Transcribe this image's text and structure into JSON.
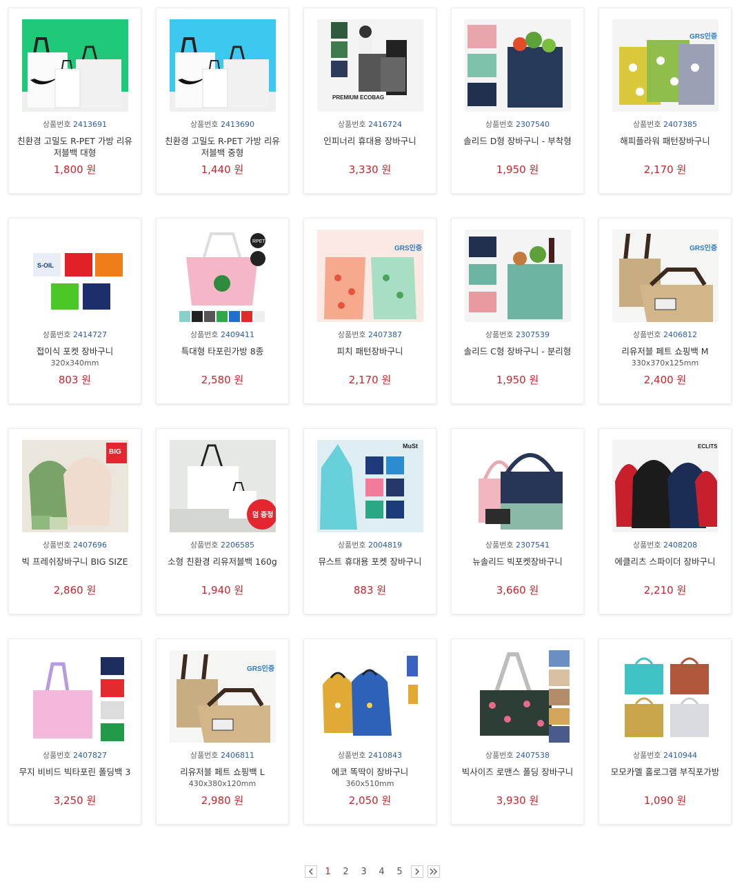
{
  "code_label": "상품번호",
  "currency": "원",
  "products": [
    {
      "code": "2413691",
      "name": "친환경 고밀도 R-PET 가방 리유저블백 대형",
      "size": "",
      "price": "1,800",
      "img": "nike-white-green"
    },
    {
      "code": "2413690",
      "name": "친환경 고밀도 R-PET 가방 리유저블백 중형",
      "size": "",
      "price": "1,440",
      "img": "nike-white-blue"
    },
    {
      "code": "2416724",
      "name": "인피너리 휴대용 장바구니",
      "size": "",
      "price": "3,330",
      "img": "models-ecobag"
    },
    {
      "code": "2307540",
      "name": "솔리드 D형 장바구니 - 부착형",
      "size": "",
      "price": "1,950",
      "img": "solid-d-navy"
    },
    {
      "code": "2407385",
      "name": "해피플라워 패턴장바구니",
      "size": "",
      "price": "2,170",
      "img": "flower-pattern"
    },
    {
      "code": "2414727",
      "name": "접이식 포켓 장바구니",
      "size": "320x340mm",
      "price": "803",
      "img": "pocket-colors"
    },
    {
      "code": "2409411",
      "name": "특대형 타포린가방 8종",
      "size": "",
      "price": "2,580",
      "img": "tarpaulin-pink"
    },
    {
      "code": "2407387",
      "name": "피치 패턴장바구니",
      "size": "",
      "price": "2,170",
      "img": "peach-pattern"
    },
    {
      "code": "2307539",
      "name": "솔리드 C형 장바구니 - 분리형",
      "size": "",
      "price": "1,950",
      "img": "solid-c-mint"
    },
    {
      "code": "2406812",
      "name": "리유저블 페트 쇼핑백 M",
      "size": "330x370x125mm",
      "price": "2,400",
      "img": "kraft-shopping"
    },
    {
      "code": "2407696",
      "name": "빅 프레쉬장바구니 BIG SIZE",
      "size": "",
      "price": "2,860",
      "img": "big-fresh"
    },
    {
      "code": "2206585",
      "name": "소형 친환경 리유저블백 160g",
      "size": "",
      "price": "1,940",
      "img": "small-white"
    },
    {
      "code": "2004819",
      "name": "뮤스트 휴대용 포켓 장바구니",
      "size": "",
      "price": "883",
      "img": "must-pocket"
    },
    {
      "code": "2307541",
      "name": "뉴솔리드 빅포켓장바구니",
      "size": "",
      "price": "3,660",
      "img": "new-solid"
    },
    {
      "code": "2408208",
      "name": "에클리츠 스파이더 장바구니",
      "size": "",
      "price": "2,210",
      "img": "spider-bags"
    },
    {
      "code": "2407827",
      "name": "무지 비비드 빅타포린 폴딩백 3",
      "size": "",
      "price": "3,250",
      "img": "vivid-pink"
    },
    {
      "code": "2406811",
      "name": "리유저블 페트 쇼핑백 L",
      "size": "430x380x120mm",
      "price": "2,980",
      "img": "kraft-shopping-l"
    },
    {
      "code": "2410843",
      "name": "에코 똑딱이 장바구니",
      "size": "360x510mm",
      "price": "2,050",
      "img": "eco-snap"
    },
    {
      "code": "2407538",
      "name": "빅사이즈 로맨스 폴딩 장바구니",
      "size": "",
      "price": "3,930",
      "img": "romance-floral"
    },
    {
      "code": "2410944",
      "name": "모모카멜 홀로그램 부직포가방",
      "size": "",
      "price": "1,090",
      "img": "hologram-bags"
    }
  ],
  "image_texts": {
    "ecobag": "PREMIUM ECOBAG",
    "grs": "GRS인증",
    "rpet": "RPET",
    "big": "BIG",
    "bonus": "덤 증정",
    "must": "MuSt",
    "eclits": "ECLITS",
    "soil": "S-OIL"
  },
  "pagination": {
    "pages": [
      "1",
      "2",
      "3",
      "4",
      "5"
    ],
    "current": "1",
    "prev_icon": "chevron-left-icon",
    "next_icon": "chevron-right-icon",
    "last_icon": "double-chevron-right-icon"
  },
  "colors": {
    "price": "#c8242b",
    "code_num": "#2a5aa8",
    "active_page": "#c8242b"
  }
}
